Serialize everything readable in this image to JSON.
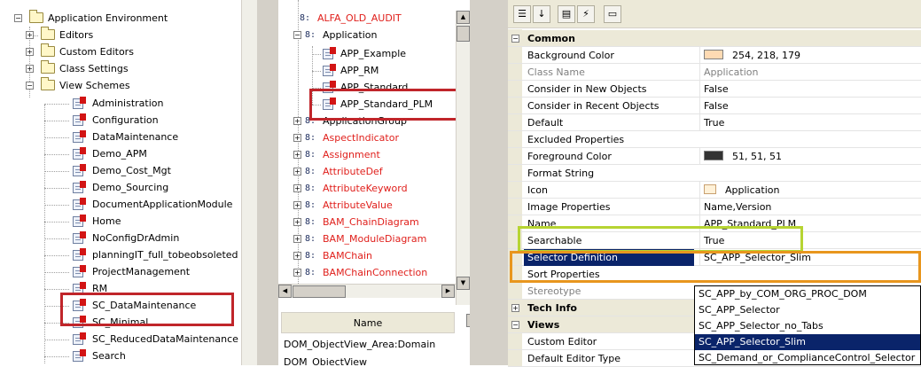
{
  "left_tree": {
    "root": "Application Environment",
    "folders": [
      "Editors",
      "Custom Editors",
      "Class Settings",
      "View Schemes"
    ],
    "schemes": [
      "Administration",
      "Configuration",
      "DataMaintenance",
      "Demo_APM",
      "Demo_Cost_Mgt",
      "Demo_Sourcing",
      "DocumentApplicationModule",
      "Home",
      "NoConfigDrAdmin",
      "planningIT_full_tobeobsoleted",
      "ProjectManagement",
      "RM",
      "SC_DataMaintenance",
      "SC_Minimal",
      "SC_ReducedDataMaintenance",
      "Search"
    ]
  },
  "class_tree": {
    "top_item": "ALFA_OLD_AUDIT",
    "application": "Application",
    "children": [
      "APP_Example",
      "APP_RM",
      "APP_Standard",
      "APP_Standard_PLM"
    ],
    "classes": [
      "ApplicationGroup",
      "AspectIndicator",
      "Assignment",
      "AttributeDef",
      "AttributeKeyword",
      "AttributeValue",
      "BAM_ChainDiagram",
      "BAM_ModuleDiagram",
      "BAMChain",
      "BAMChainConnection"
    ]
  },
  "list": {
    "column": "Name",
    "row": "DOM_ObjectView_Area:Domain",
    "row2": "DOM_ObjectView"
  },
  "toolbar": {
    "icons": [
      "categorized-icon",
      "alphabetical-icon",
      "properties-icon",
      "events-icon",
      "property-pages-icon"
    ]
  },
  "properties": {
    "cat_common": "Common",
    "rows": [
      {
        "name": "Background Color",
        "value": "254, 218, 179",
        "swatch": "#fedab3"
      },
      {
        "name": "Class Name",
        "value": "Application",
        "grey": true
      },
      {
        "name": "Consider in New Objects",
        "value": "False"
      },
      {
        "name": "Consider in Recent Objects",
        "value": "False"
      },
      {
        "name": "Default",
        "value": "True"
      },
      {
        "name": "Excluded Properties",
        "value": ""
      },
      {
        "name": "Foreground Color",
        "value": "51, 51, 51",
        "swatch": "#333333"
      },
      {
        "name": "Format String",
        "value": ""
      },
      {
        "name": "Icon",
        "value": "Application"
      },
      {
        "name": "Image Properties",
        "value": "Name,Version"
      },
      {
        "name": "Name",
        "value": "APP_Standard_PLM"
      },
      {
        "name": "Searchable",
        "value": "True"
      },
      {
        "name": "Selector Definition",
        "value": "SC_APP_Selector_Slim"
      },
      {
        "name": "Sort Properties",
        "value": ""
      },
      {
        "name": "Stereotype",
        "value": "",
        "grey": true
      }
    ],
    "cat_tech": "Tech Info",
    "cat_views": "Views",
    "views_rows": [
      {
        "name": "Custom Editor"
      },
      {
        "name": "Default Editor Type"
      }
    ]
  },
  "dropdown": {
    "options": [
      "SC_APP_by_COM_ORG_PROC_DOM",
      "SC_APP_Selector",
      "SC_APP_Selector_no_Tabs",
      "SC_APP_Selector_Slim",
      "SC_Demand_or_ComplianceControl_Selector"
    ],
    "selected_index": 3
  },
  "colors": {
    "highlight_red": "#c0252a",
    "highlight_green": "#b6d432",
    "highlight_orange": "#e8961e",
    "selection": "#0a246a",
    "class_red": "#e0201c"
  }
}
